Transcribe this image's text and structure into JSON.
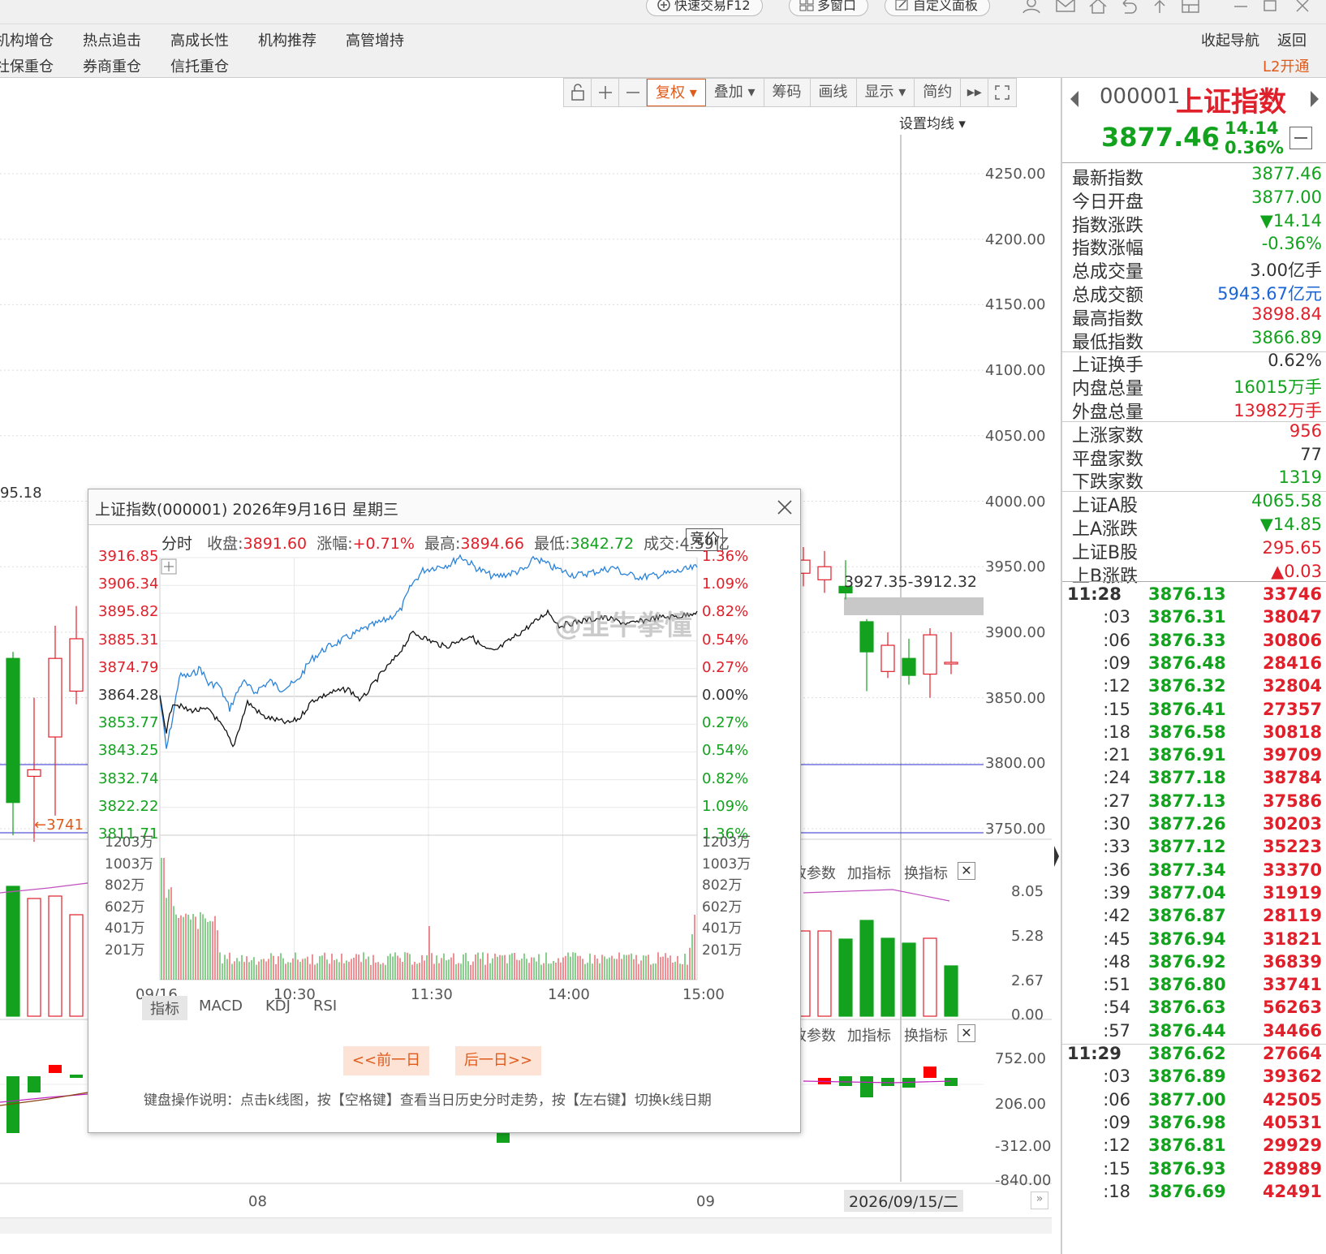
{
  "topbar": {
    "quick_trade": "快速交易F12",
    "multi_window": "多窗口",
    "custom_panel": "自定义面板"
  },
  "menu": {
    "row1": [
      "机构增仓",
      "热点追击",
      "高成长性",
      "机构推荐",
      "高管增持"
    ],
    "row2": [
      "社保重仓",
      "券商重仓",
      "信托重仓"
    ],
    "collapse": "收起导航",
    "back": "返回",
    "l2": "L2开通"
  },
  "toolbar": {
    "fuquan": "复权",
    "overlay": "叠加",
    "chips": "筹码",
    "draw": "画线",
    "display": "显示",
    "simple": "简约",
    "set_ma": "设置均线"
  },
  "main_axis": [
    "4250.00",
    "4200.00",
    "4150.00",
    "4100.00",
    "4050.00",
    "4000.00",
    "3950.00",
    "3900.00",
    "3850.00",
    "3800.00",
    "3750.00"
  ],
  "main_labels": {
    "left_price": "95.18",
    "low_arrow": "←3741",
    "range": "3927.35-3912.32"
  },
  "vol_axis": [
    "8.05",
    "5.28",
    "2.67",
    "0.00"
  ],
  "macd_axis": [
    "752.00",
    "206.00",
    "-312.00",
    "-840.00"
  ],
  "sub_tabs": {
    "params": "改参数",
    "add_ind": "加指标",
    "swap_ind": "换指标"
  },
  "bottom_axis": {
    "m08": "08",
    "m09": "09",
    "date": "2026/09/15/二"
  },
  "popup": {
    "title": "上证指数(000001) 2026年9月16日 星期三",
    "fenshi": "分时",
    "close_label": "收盘:",
    "close": "3891.60",
    "change_label": "涨幅:",
    "change": "+0.71%",
    "high_label": "最高:",
    "high": "3894.66",
    "low_label": "最低:",
    "low": "3842.72",
    "turnover": "成交:4.59亿",
    "auction": "竞价",
    "price_axis": [
      "3916.85",
      "3906.34",
      "3895.82",
      "3885.31",
      "3874.79",
      "3864.28",
      "3853.77",
      "3843.25",
      "3832.74",
      "3822.22",
      "3811.71"
    ],
    "pct_axis": [
      "1.36%",
      "1.09%",
      "0.82%",
      "0.54%",
      "0.27%",
      "0.00%",
      "0.27%",
      "0.54%",
      "0.82%",
      "1.09%",
      "1.36%"
    ],
    "vol_axis": [
      "1203万",
      "1003万",
      "802万",
      "602万",
      "401万",
      "201万"
    ],
    "time_axis": [
      "09/16",
      "10:30",
      "11:30",
      "14:00",
      "15:00"
    ],
    "ind_tabs": [
      "指标",
      "MACD",
      "KDJ",
      "RSI"
    ],
    "prev_day": "<<前一日",
    "next_day": "后一日>>",
    "keyboard_help": "键盘操作说明：点击k线图，按【空格键】查看当日历史分时走势，按【左右键】切换k线日期",
    "watermark": "@韭牛拳憧"
  },
  "quote": {
    "code": "000001",
    "name": "上证指数",
    "price": "3877.46",
    "change": "- 14.14",
    "pct": "- 0.36%",
    "rows": [
      {
        "label": "最新指数",
        "value": "3877.46",
        "color": "green"
      },
      {
        "label": "今日开盘",
        "value": "3877.00",
        "color": "green"
      },
      {
        "label": "指数涨跌",
        "value": "▼14.14",
        "color": "green"
      },
      {
        "label": "指数涨幅",
        "value": "-0.36%",
        "color": "green"
      },
      {
        "label": "总成交量",
        "value": "3.00亿手",
        "color": "black"
      },
      {
        "label": "总成交额",
        "value": "5943.67亿元",
        "color": "blue"
      },
      {
        "label": "最高指数",
        "value": "3898.84",
        "color": "red"
      },
      {
        "label": "最低指数",
        "value": "3866.89",
        "color": "green"
      },
      {
        "label": "上证换手",
        "value": "0.62%",
        "color": "black"
      },
      {
        "label": "内盘总量",
        "value": "16015万手",
        "color": "green"
      },
      {
        "label": "外盘总量",
        "value": "13982万手",
        "color": "red"
      },
      {
        "label": "上涨家数",
        "value": "956",
        "color": "red"
      },
      {
        "label": "平盘家数",
        "value": "77",
        "color": "black"
      },
      {
        "label": "下跌家数",
        "value": "1319",
        "color": "green"
      },
      {
        "label": "上证A股",
        "value": "4065.58",
        "color": "green"
      },
      {
        "label": "上A涨跌",
        "value": "▼14.85",
        "color": "green"
      },
      {
        "label": "上证B股",
        "value": "295.65",
        "color": "red"
      },
      {
        "label": "上B涨跌",
        "value": "▲0.03",
        "color": "red"
      }
    ],
    "ticks": [
      {
        "t": "11:28",
        "p": "3876.13",
        "v": "33746"
      },
      {
        "t": ":03",
        "p": "3876.31",
        "v": "38047"
      },
      {
        "t": ":06",
        "p": "3876.33",
        "v": "30806"
      },
      {
        "t": ":09",
        "p": "3876.48",
        "v": "28416"
      },
      {
        "t": ":12",
        "p": "3876.32",
        "v": "32804"
      },
      {
        "t": ":15",
        "p": "3876.41",
        "v": "27357"
      },
      {
        "t": ":18",
        "p": "3876.58",
        "v": "30818"
      },
      {
        "t": ":21",
        "p": "3876.91",
        "v": "39709"
      },
      {
        "t": ":24",
        "p": "3877.18",
        "v": "38784"
      },
      {
        "t": ":27",
        "p": "3877.13",
        "v": "37586"
      },
      {
        "t": ":30",
        "p": "3877.26",
        "v": "30203"
      },
      {
        "t": ":33",
        "p": "3877.12",
        "v": "35223"
      },
      {
        "t": ":36",
        "p": "3877.34",
        "v": "33370"
      },
      {
        "t": ":39",
        "p": "3877.04",
        "v": "31919"
      },
      {
        "t": ":42",
        "p": "3876.87",
        "v": "28119"
      },
      {
        "t": ":45",
        "p": "3876.94",
        "v": "31821"
      },
      {
        "t": ":48",
        "p": "3876.92",
        "v": "36839"
      },
      {
        "t": ":51",
        "p": "3876.80",
        "v": "33741"
      },
      {
        "t": ":54",
        "p": "3876.63",
        "v": "56263"
      },
      {
        "t": ":57",
        "p": "3876.44",
        "v": "34466"
      },
      {
        "t": "11:29",
        "p": "3876.62",
        "v": "27664"
      },
      {
        "t": ":03",
        "p": "3876.89",
        "v": "39362"
      },
      {
        "t": ":06",
        "p": "3877.00",
        "v": "42505"
      },
      {
        "t": ":09",
        "p": "3876.98",
        "v": "40531"
      },
      {
        "t": ":12",
        "p": "3876.81",
        "v": "29929"
      },
      {
        "t": ":15",
        "p": "3876.93",
        "v": "28989"
      },
      {
        "t": ":18",
        "p": "3876.69",
        "v": "42491"
      }
    ]
  },
  "colors": {
    "up": "#e0202a",
    "down": "#13a21e",
    "accent": "#e05a1a",
    "blue": "#1a64d6"
  }
}
